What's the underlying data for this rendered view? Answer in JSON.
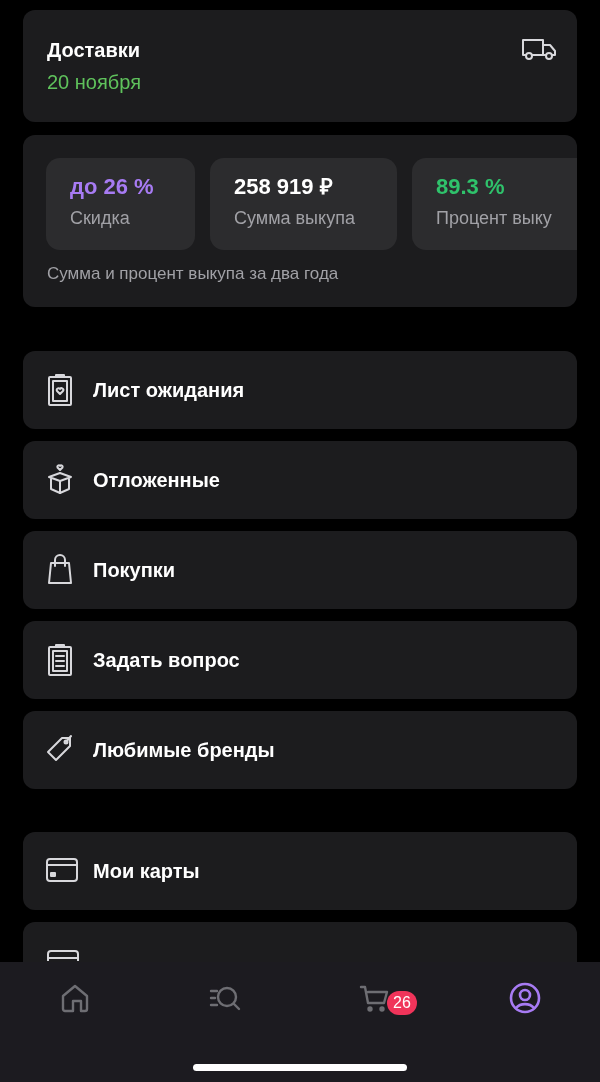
{
  "delivery": {
    "title": "Доставки",
    "date": "20 ноября"
  },
  "stats": {
    "tiles": [
      {
        "value": "до 26 %",
        "label": "Скидка",
        "color": "#a77bf3"
      },
      {
        "value": "258 919 ₽",
        "label": "Сумма выкупа",
        "color": "#ffffff"
      },
      {
        "value": "89.3 %",
        "label": "Процент выку",
        "color": "#2fc26b"
      }
    ],
    "note": "Сумма и процент выкупа за два года"
  },
  "menu_groups": [
    [
      {
        "kind": "row",
        "label": "Лист ожидания"
      },
      {
        "kind": "row",
        "label": "Отложенные"
      },
      {
        "kind": "row",
        "label": "Покупки"
      },
      {
        "kind": "row",
        "label": "Задать вопрос"
      },
      {
        "kind": "row",
        "label": "Любимые бренды"
      }
    ],
    [
      {
        "kind": "row",
        "label": "Мои карты"
      },
      {
        "kind": "partial"
      }
    ]
  ],
  "tab_bar": [
    {
      "selected": false
    },
    {
      "selected": false
    },
    {
      "selected": false,
      "badge": "26"
    },
    {
      "selected": true
    }
  ]
}
